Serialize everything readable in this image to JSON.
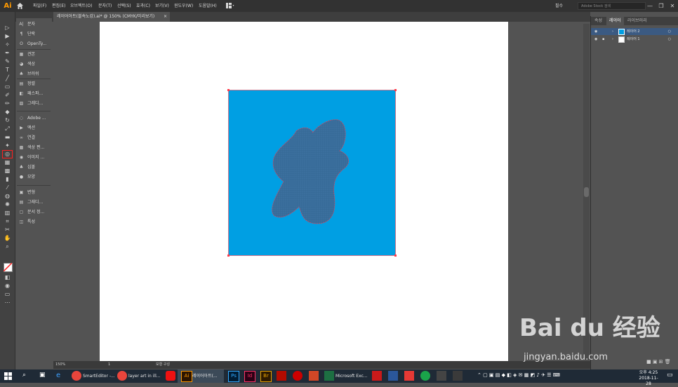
{
  "menubar": {
    "app_logo": "Ai",
    "items": [
      "파일(F)",
      "편집(E)",
      "오브젝트(O)",
      "문자(T)",
      "선택(S)",
      "효과(C)",
      "보기(V)",
      "윈도우(W)",
      "도움말(H)"
    ],
    "workspace": "필수",
    "stock_search_placeholder": "Adobe Stock 검색",
    "window_buttons": [
      "—",
      "❐",
      "✕"
    ]
  },
  "document_tab": {
    "title": "레이어아트(블속노강).ai* @ 150% (CMYK/미리보기)",
    "close": "×"
  },
  "panels": {
    "items": [
      {
        "icon": "A|",
        "label": "문자"
      },
      {
        "icon": "¶",
        "label": "단락"
      },
      {
        "icon": "O",
        "label": "OpenTy..."
      },
      {
        "icon": "▦",
        "label": "견본"
      },
      {
        "icon": "◕",
        "label": "색상"
      },
      {
        "icon": "♣",
        "label": "브러쉬"
      },
      {
        "icon": "▤",
        "label": "정렬"
      },
      {
        "icon": "◧",
        "label": "패스파..."
      },
      {
        "icon": "▨",
        "label": "그레디..."
      },
      {
        "icon": "◌",
        "label": "Adobe ..."
      },
      {
        "icon": "▶",
        "label": "액션"
      },
      {
        "icon": "∞",
        "label": "연결"
      },
      {
        "icon": "▩",
        "label": "색상 편..."
      },
      {
        "icon": "◉",
        "label": "이미지 ..."
      },
      {
        "icon": "♣",
        "label": "심볼"
      },
      {
        "icon": "●",
        "label": "모양"
      },
      {
        "icon": "▣",
        "label": "변형"
      },
      {
        "icon": "▤",
        "label": "그래디..."
      },
      {
        "icon": "▢",
        "label": "문서 정..."
      },
      {
        "icon": "◫",
        "label": "특성"
      }
    ]
  },
  "statusbar": {
    "zoom": "150%",
    "page": "1",
    "tool_label": "모형 구성"
  },
  "right_panel": {
    "tabs": [
      "속성",
      "레이어",
      "라이브러리"
    ],
    "layers": [
      {
        "name": "레이어 2",
        "color": "#1f6bff"
      },
      {
        "name": "레이어 1",
        "color": "#ffffff"
      }
    ]
  },
  "colors": {
    "square_fill": "#009fe3",
    "blob_fill": "#3b6f9d",
    "selection": "#ff3b4a"
  },
  "watermark": {
    "logo": "Bai du 经验",
    "url": "jingyan.baidu.com"
  },
  "taskbar": {
    "apps": [
      {
        "label": "SmartEditor -..."
      },
      {
        "label": "layer art in ill..."
      },
      {
        "label": "레이어아트(..."
      },
      {
        "label": "Microsoft Exc..."
      }
    ],
    "time": "오후 4:25",
    "date": "2018-11-28"
  }
}
